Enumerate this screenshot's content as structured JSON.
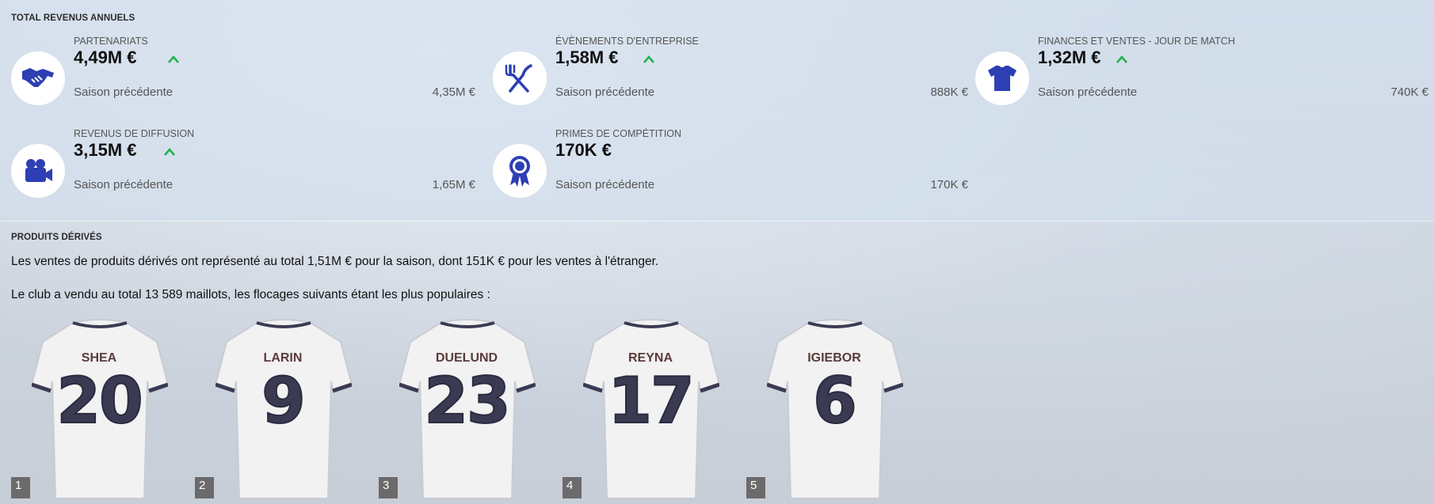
{
  "revenue_section": {
    "title": "TOTAL REVENUS ANNUELS",
    "cards": [
      {
        "label": "PARTENARIATS",
        "value": "4,49M €",
        "trend": "up",
        "prev_label": "Saison précédente",
        "prev_value": "4,35M €",
        "icon": "handshake-icon"
      },
      {
        "label": "ÉVÈNEMENTS D'ENTREPRISE",
        "value": "1,58M €",
        "trend": "up",
        "prev_label": "Saison précédente",
        "prev_value": "888K €",
        "icon": "fork-knife-icon"
      },
      {
        "label": "FINANCES ET VENTES - JOUR DE MATCH",
        "value": "1,32M €",
        "trend": "up",
        "prev_label": "Saison précédente",
        "prev_value": "740K €",
        "icon": "shirt-icon"
      },
      {
        "label": "REVENUS DE DIFFUSION",
        "value": "3,15M €",
        "trend": "up",
        "prev_label": "Saison précédente",
        "prev_value": "1,65M €",
        "icon": "video-camera-icon"
      },
      {
        "label": "PRIMES DE COMPÉTITION",
        "value": "170K €",
        "trend": "none",
        "prev_label": "Saison précédente",
        "prev_value": "170K €",
        "icon": "award-ribbon-icon"
      }
    ]
  },
  "merch_section": {
    "title": "PRODUITS DÉRIVÉS",
    "sales_text": "Les ventes de produits dérivés ont représenté au total 1,51M € pour la saison, dont 151K € pour les ventes à l'étranger.",
    "shirts_text": "Le club a vendu au total 13 589 maillots, les flocages suivants étant les plus populaires :",
    "shirts": [
      {
        "rank": "1",
        "name": "SHEA",
        "number": "20"
      },
      {
        "rank": "2",
        "name": "LARIN",
        "number": "9"
      },
      {
        "rank": "3",
        "name": "DUELUND",
        "number": "23"
      },
      {
        "rank": "4",
        "name": "REYNA",
        "number": "17"
      },
      {
        "rank": "5",
        "name": "IGIEBOR",
        "number": "6"
      }
    ]
  },
  "colors": {
    "icon_blue": "#2d3fb3",
    "trend_green": "#22b24c",
    "rank_badge": "#6b6b6b"
  }
}
